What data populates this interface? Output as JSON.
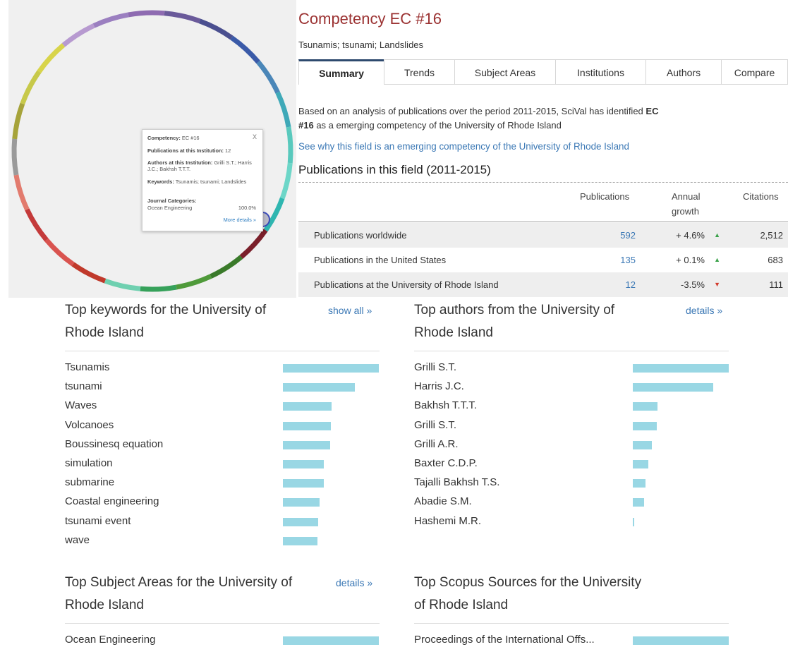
{
  "competency": {
    "title": "Competency EC #16",
    "subtitle": "Tsunamis; tsunami; Landslides"
  },
  "tabs": [
    "Summary",
    "Trends",
    "Subject Areas",
    "Institutions",
    "Authors",
    "Compare"
  ],
  "active_tab": "Summary",
  "popup": {
    "competency_label": "Competency:",
    "competency_value": "EC #16",
    "close": "X",
    "pubs_label": "Publications at this Institution:",
    "pubs_value": "12",
    "authors_label": "Authors at this Institution:",
    "authors_value": "Grilli S.T.; Harris J.C.; Bakhsh T.T.T.",
    "keywords_label": "Keywords:",
    "keywords_value": "Tsunamis; tsunami; Landslides",
    "journal_label": "Journal Categories:",
    "journal_name": "Ocean Engineering",
    "journal_pct": "100.0%",
    "more": "More details »"
  },
  "description": {
    "part1": "Based on an analysis of publications over the period 2011-2015, SciVal has identified ",
    "bold": "EC #16",
    "part2": " as a emerging competency of the University of Rhode Island"
  },
  "why_link": "See why this field is an emerging competency of the University of Rhode Island",
  "publications": {
    "heading": "Publications in this field (2011-2015)",
    "col_pubs": "Publications",
    "col_growth": "Annual growth",
    "col_cites": "Citations",
    "rows": [
      {
        "label": "Publications worldwide",
        "pubs": "592",
        "growth": "+ 4.6%",
        "trend": "up",
        "cites": "2,512"
      },
      {
        "label": "Publications in the United States",
        "pubs": "135",
        "growth": "+ 0.1%",
        "trend": "up",
        "cites": "683"
      },
      {
        "label": "Publications at the University of Rhode Island",
        "pubs": "12",
        "growth": "-3.5%",
        "trend": "down",
        "cites": "111"
      }
    ]
  },
  "keywords_section": {
    "title_line1": "Top keywords for the University of",
    "title_line2": "Rhode Island",
    "link": "show all »",
    "items": [
      {
        "label": "Tsunamis",
        "value": 1.0
      },
      {
        "label": "tsunami",
        "value": 0.75
      },
      {
        "label": "Waves",
        "value": 0.51
      },
      {
        "label": "Volcanoes",
        "value": 0.5
      },
      {
        "label": "Boussinesq equation",
        "value": 0.49
      },
      {
        "label": "simulation",
        "value": 0.43
      },
      {
        "label": "submarine",
        "value": 0.43
      },
      {
        "label": "Coastal engineering",
        "value": 0.38
      },
      {
        "label": "tsunami event",
        "value": 0.37
      },
      {
        "label": "wave",
        "value": 0.36
      }
    ]
  },
  "authors_section": {
    "title_line1": "Top authors from the University of",
    "title_line2": "Rhode Island",
    "link": "details »",
    "items": [
      {
        "label": "Grilli S.T.",
        "value": 1.0
      },
      {
        "label": "Harris J.C.",
        "value": 0.84
      },
      {
        "label": "Bakhsh T.T.T.",
        "value": 0.26
      },
      {
        "label": "Grilli S.T.",
        "value": 0.25
      },
      {
        "label": "Grilli A.R.",
        "value": 0.2
      },
      {
        "label": "Baxter C.D.P.",
        "value": 0.16
      },
      {
        "label": "Tajalli Bakhsh T.S.",
        "value": 0.13
      },
      {
        "label": "Abadie S.M.",
        "value": 0.12
      },
      {
        "label": "Hashemi M.R.",
        "value": 0.01
      }
    ]
  },
  "subject_section": {
    "title_line1": "Top Subject Areas for the University of",
    "title_line2": "Rhode Island",
    "link": "details »",
    "items": [
      {
        "label": "Ocean Engineering",
        "value": 1.0
      }
    ]
  },
  "sources_section": {
    "title_line1": "Top Scopus Sources for the University",
    "title_line2": "of Rhode Island",
    "items": [
      {
        "label": "Proceedings of the International Offs...",
        "value": 1.0
      }
    ]
  },
  "wheel_colors": [
    "#8e6bb1",
    "#6a5a9a",
    "#4a4f8f",
    "#3a5aa8",
    "#4a86b8",
    "#3fa9b8",
    "#59c9bd",
    "#6dd6c8",
    "#2fb6b0",
    "#7a1f2a",
    "#3a7a2a",
    "#4f9a3a",
    "#36a15a",
    "#6fd0b0",
    "#c0392b",
    "#d9534f",
    "#c43a3a",
    "#e27b6e",
    "#9a9a9a",
    "#a6a33a",
    "#c7c94a",
    "#d8d44a",
    "#b79ad0",
    "#9b7fc0"
  ]
}
